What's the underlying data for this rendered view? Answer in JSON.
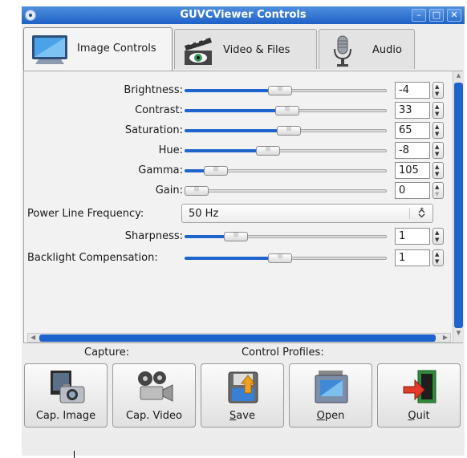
{
  "window": {
    "title": "GUVCViewer Controls"
  },
  "tabs": [
    {
      "label": "Image Controls",
      "active": true,
      "icon": "monitor-icon"
    },
    {
      "label": "Video & Files",
      "active": false,
      "icon": "film-eye-icon"
    },
    {
      "label": "Audio",
      "active": false,
      "icon": "microphone-icon"
    }
  ],
  "controls": {
    "brightness": {
      "label": "Brightness:",
      "value": "-4",
      "level": 0.47
    },
    "contrast": {
      "label": "Contrast:",
      "value": "33",
      "level": 0.51
    },
    "saturation": {
      "label": "Saturation:",
      "value": "65",
      "level": 0.52
    },
    "hue": {
      "label": "Hue:",
      "value": "-8",
      "level": 0.4
    },
    "gamma": {
      "label": "Gamma:",
      "value": "105",
      "level": 0.11
    },
    "gain": {
      "label": "Gain:",
      "value": "0",
      "level": 0.0
    },
    "power_line": {
      "label": "Power Line Frequency:",
      "value": "50 Hz"
    },
    "sharpness": {
      "label": "Sharpness:",
      "value": "1",
      "level": 0.22
    },
    "backlight": {
      "label": "Backlight Compensation:",
      "value": "1",
      "level": 0.47
    }
  },
  "bottom": {
    "capture_label": "Capture:",
    "profiles_label": "Control Profiles:",
    "buttons": [
      {
        "label": "Cap. Image",
        "icon": "camera-photo-icon"
      },
      {
        "label": "Cap. Video",
        "icon": "video-camera-icon"
      },
      {
        "label": "Save",
        "mnemonic": "S",
        "icon": "save-disk-icon"
      },
      {
        "label": "Open",
        "mnemonic": "O",
        "icon": "open-folder-icon"
      },
      {
        "label": "Quit",
        "mnemonic": "Q",
        "icon": "exit-door-icon"
      }
    ]
  },
  "colors": {
    "accent": "#1f63cc",
    "titlebar": "#2d6fcf"
  }
}
